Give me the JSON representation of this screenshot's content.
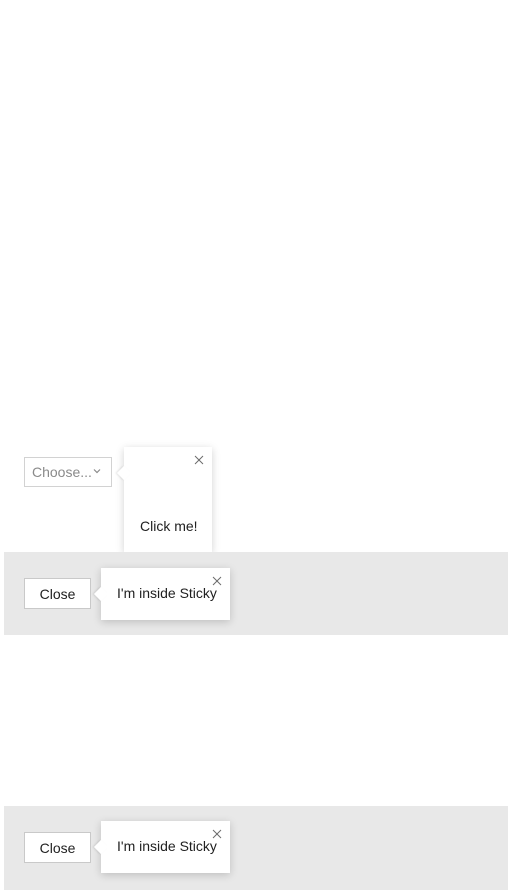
{
  "select": {
    "placeholder": "Choose...",
    "icon": "chevron-down-icon"
  },
  "popover_top": {
    "text": "Click me!",
    "close_icon": "close-icon"
  },
  "sticky_sections": [
    {
      "close_button_label": "Close",
      "popover_text": "I'm inside Sticky",
      "close_icon": "close-icon"
    },
    {
      "close_button_label": "Close",
      "popover_text": "I'm inside Sticky",
      "close_icon": "close-icon"
    }
  ],
  "colors": {
    "sticky_background": "#e8e8e8",
    "border": "#d2d2d2",
    "placeholder_text": "#8a8a8a"
  }
}
